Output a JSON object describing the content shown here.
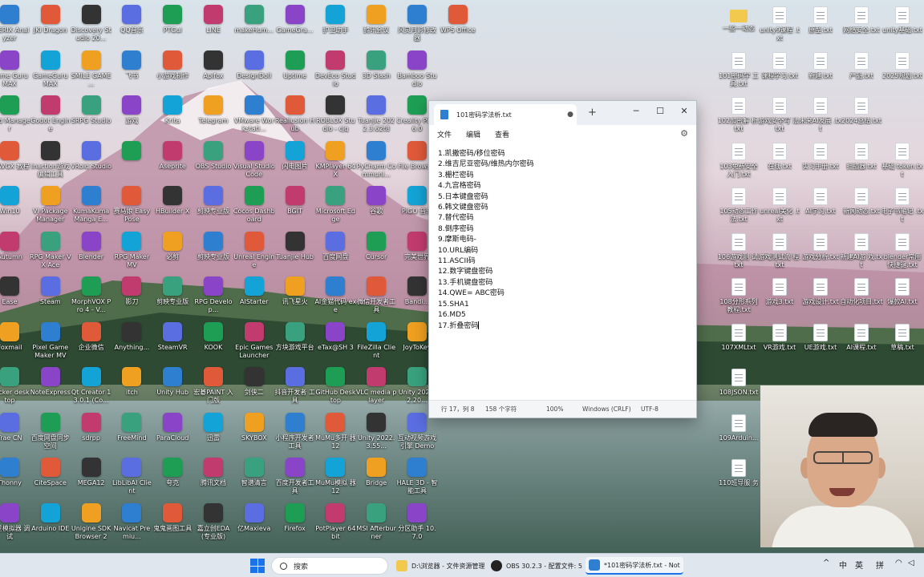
{
  "desktop": {
    "columns": [
      [
        "STERIX\nAnalyzer",
        "Game Guru\nMAX",
        "Mod Manager",
        "N-AVGX\n教程",
        "Win10",
        "Autumn",
        "Ease",
        "Foxmail",
        "Docker\ndesktop",
        "Trae CN",
        "Thonny",
        "火星模拟器\n调试"
      ],
      [
        "JKI Dragon",
        "GameGuru\nMAX",
        "Godot\nEngine",
        "Inaction游戏\n编辑工具",
        "VI Package\nManager",
        "RPG Maker\nVX Ace",
        "Steam",
        "Pixel Game\nMaker MV",
        "NoteExpress",
        "百度网盘同步\n空间",
        "CiteSpace",
        "Arduino IDE"
      ],
      [
        "Discovery\nStudio 20...",
        "SMILE\nGAME ...",
        "SRPG Studio",
        "VRoid\nStudio",
        "KumaKuma\nManga E...",
        "Blender",
        "MorphVOX\nPro 4 - V...",
        "企业微信",
        "Qt Creator\n13.0.1 (Co...",
        "sdrpp",
        "MEGA12",
        "Unigine SDK\nBrowser 2"
      ],
      [
        "QQ音乐",
        "飞书",
        "游戏",
        "",
        "赛马娘\nEasy Pose",
        "RPG Maker\nMV",
        "影刀",
        "Anything...",
        "itch",
        "FreeMind",
        "LibLibAI\nClient",
        "Navicat\nPremiu..."
      ],
      [
        "PTGui",
        "小游戏制作",
        "Krita",
        "Aseprite",
        "HBuilder X",
        "必剪",
        "剪映专业版",
        "SteamVR",
        "Unity Hub",
        "ParaCloud",
        "夸克",
        "鬼鬼画图工具"
      ],
      [
        "LINE",
        "Apifox",
        "Telegram",
        "OBS Studio",
        "剪映专业版",
        "剪映专业版",
        "RPG\nDevelop...",
        "KOOK",
        "宏碁PAINT\n入门版",
        "迅雷",
        "腾讯文档",
        "嘉立创EDA\n(专业版)"
      ],
      [
        "makeHum...",
        "DesignDoll",
        "VMware\nWorkstati...",
        "Visual\nStudio Code",
        "Cocos\nDashboard",
        "Unreal\nEngine",
        "AIStarter",
        "Epic Games\nLauncher",
        "剑侠二",
        "SKYBOX",
        "智谱清言",
        "亿Maxieva"
      ],
      [
        "GameGra...",
        "Uptime",
        "Reallusion\nHub",
        "闪电图片",
        "BGIT",
        "Tuanjie Hub",
        "讯飞星火",
        "方块游戏平台",
        "抖音开发者\n工具",
        "小程序开发者\n工具",
        "百度开发者工\n具",
        "Firefox"
      ],
      [
        "护卫助手",
        "DevEco\nStudio",
        "ROBLOX\nStudio - cjq",
        "KMPlayer\n64X",
        "Microsoft\nEdge",
        "百度网盘",
        "AI金猫代码\nexe",
        "eTax@SH 3",
        "GitHub\nDesktop",
        "MuMu多开\n器12",
        "MuMu模拟\n器12",
        "PotPlayer 64\nbit"
      ],
      [
        "腾讯会议",
        "3D Slash",
        "Tuanjie\n2022.3.62t8",
        "PyCharm\nCommuni...",
        "谷歌",
        "Cursor",
        "微信开发者工\n具",
        "FileZilla\nClient",
        "VLC media\nplayer",
        "Unity\n2022.3.55...",
        "Bridge",
        "MSI\nAfterburner"
      ],
      [
        "风灵月影修改\n器",
        "Bamboo\nStudio",
        "Creality\nPrint 6.0",
        "File Brows...",
        "PIGO 音乐",
        "完美世界",
        "Bandi...",
        "JoyToKey",
        "Unity\n2023.2.20...",
        "互动视频游戏\n引擎 Demo",
        "HALE 3D -\n智能工具",
        "分区助手\n10.7.0"
      ],
      [
        "WPS Office"
      ]
    ]
  },
  "files": {
    "col1": [
      "一些一动态",
      "101密码学\n工具.txt",
      "102加密解\n析.txt",
      "103免费安全\n入门.txt",
      "105动态工作\n法.txt",
      "106游戏测\n试.txt",
      "108分形系列\n教程.txt",
      "107XMLtxt",
      "108JSON.txt",
      "109Arduin...",
      "110班导服\n务"
    ],
    "col2": [
      "unity9课程\n.txt",
      "课程学习.txt",
      "游戏安全写\n法.txt",
      "在线.txt",
      "unreal美化\n.txt",
      "游戏测试流\n程.txt",
      "游戏3.txt",
      "VR游戏.txt"
    ],
    "col3": [
      "原型.txt",
      "新建.txt",
      "未来AI发展\n.txt",
      "实习手册.txt",
      "AI学习.txt",
      "游戏分析.txt",
      "游戏设计.txt",
      "UE游戏.txt"
    ],
    "col4": [
      "网络安全.txt",
      "产品.txt",
      "2024总结.txt",
      "扫描器.txt",
      "新闻动态.txt",
      "新建AI游\n戏.txt",
      "自动化项目.txt",
      "AI课程.txt"
    ],
    "col5": [
      "unity基础.txt",
      "2025规划.txt",
      "",
      "基础\ntoken.txt",
      "电子书笔记\n.txt",
      "blender常用\n快捷键.txt",
      "爆款AI.txt",
      "草稿.txt"
    ]
  },
  "notepad": {
    "tab_title": "101密码学法析.txt",
    "menu": [
      "文件",
      "编辑",
      "查看"
    ],
    "lines": [
      "1.凯撒密码/移位密码",
      "2.维吉尼亚密码/维热内尔密码",
      "3.栅栏密码",
      "4.九宫格密码",
      "5.日本键盘密码",
      "6.韩文键盘密码",
      "7.替代密码",
      "8.倒序密码",
      "9.摩斯电码-",
      "10.URL编码",
      "11.ASCII码",
      "12.数字键盘密码",
      "13.手机键盘密码",
      "14.QWE= ABC密码",
      "15.SHA1",
      "16.MD5",
      "17.折叠密码"
    ],
    "status": {
      "position": "行 17，列 8",
      "chars": "158 个字符",
      "zoom": "100%",
      "line_ending": "Windows (CRLF)",
      "encoding": "UTF-8"
    }
  },
  "taskbar": {
    "search_label": "搜索",
    "items": [
      "D:\\浏览器 - 文件资源管理",
      "OBS 30.2.3 - 配置文件: 5",
      "*101密码学法析.txt - Not"
    ],
    "tray": [
      "^",
      "中",
      "英",
      "拼"
    ]
  },
  "colors": {
    "accent": "#1a73e8",
    "folder": "#f3c94d",
    "icon_palette": [
      "#2f7fd1",
      "#8a44c8",
      "#1e9e55",
      "#e05a3a",
      "#14a3d6",
      "#c23b6e",
      "#333333",
      "#f0a020",
      "#3aa17e",
      "#5b6ee1"
    ]
  }
}
